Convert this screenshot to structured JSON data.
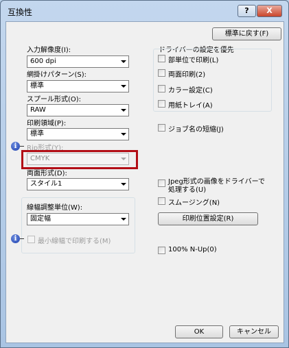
{
  "window": {
    "title": "互換性",
    "help_label": "?",
    "close_label": "X"
  },
  "reset_button": "標準に戻す(F)",
  "left": {
    "resolution": {
      "label": "入力解像度(I):",
      "value": "600 dpi"
    },
    "pattern": {
      "label": "網掛けパターン(S):",
      "value": "標準"
    },
    "spool": {
      "label": "スプール形式(O):",
      "value": "RAW"
    },
    "print_area": {
      "label": "印刷領域(P):",
      "value": "標準"
    },
    "rip": {
      "label": "Rip形式(Y):",
      "value": "CMYK"
    },
    "duplex": {
      "label": "両面形式(D):",
      "value": "スタイル1"
    },
    "line_width_unit": {
      "label": "線幅調整単位(W):",
      "value": "固定幅"
    },
    "min_line_print": "最小線幅で印刷する(M)"
  },
  "right": {
    "driver_priority_title": "ドライバーの設定を優先",
    "driver_items": [
      "部単位で印刷(L)",
      "両面印刷(2)",
      "カラー設定(C)",
      "用紙トレイ(A)"
    ],
    "job_name_short": "ジョブ名の短縮(J)",
    "jpeg_driver_line1": "Jpeg形式の画像をドライバーで",
    "jpeg_driver_line2": "処理する(U)",
    "smoothing": "スムージング(N)",
    "print_position_button": "印刷位置設定(R)",
    "nup": "100% N-Up(0)"
  },
  "footer": {
    "ok": "OK",
    "cancel": "キャンセル"
  },
  "colors": {
    "highlight": "#b20e16",
    "title_bar": "#b9d1ea",
    "close_button": "#c9452b"
  }
}
